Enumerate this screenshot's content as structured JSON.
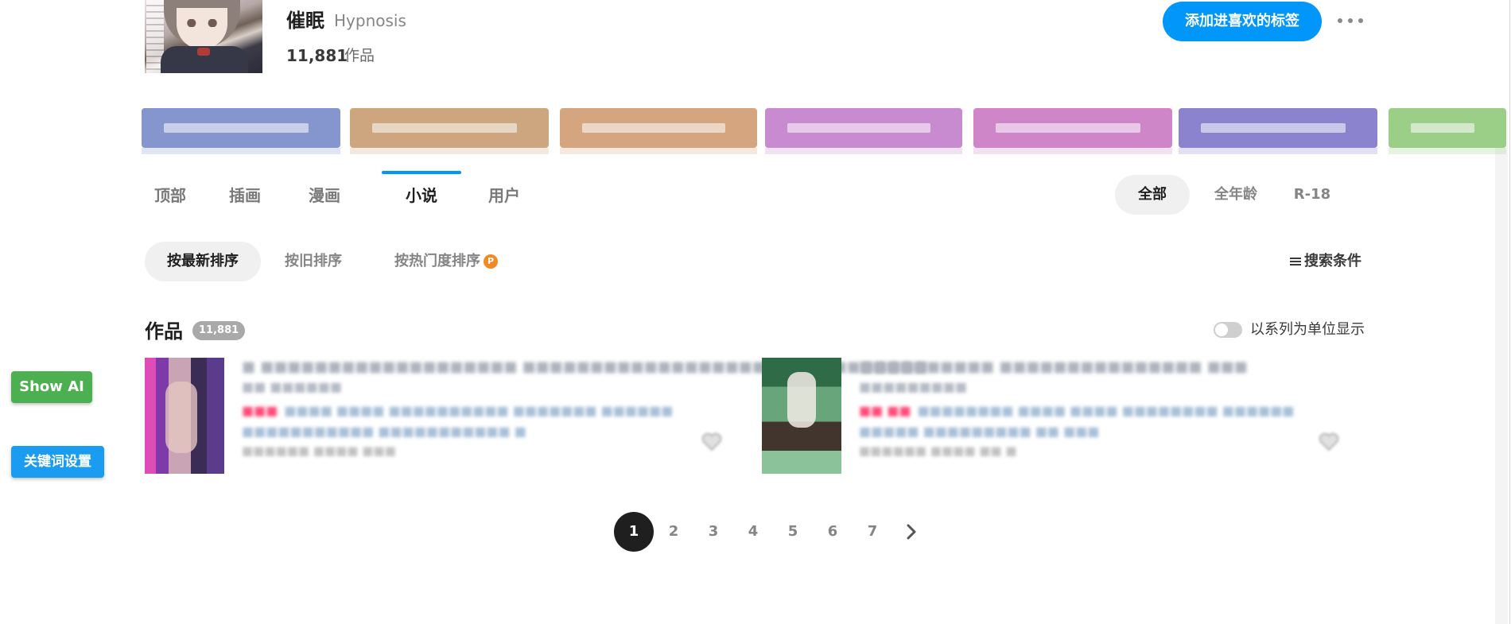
{
  "header": {
    "title": "催眠",
    "roman": "Hypnosis",
    "count": "11,881",
    "count_unit": "作品",
    "fav_button": "添加进喜欢的标签"
  },
  "related_tags": [
    {
      "color": "#8596cf"
    },
    {
      "color": "#cda57f"
    },
    {
      "color": "#d4a57e"
    },
    {
      "color": "#c98bcf"
    },
    {
      "color": "#cf86c9"
    },
    {
      "color": "#8b83cd"
    },
    {
      "color": "#9bcf88"
    }
  ],
  "categories": [
    "顶部",
    "插画",
    "漫画",
    "小说",
    "用户"
  ],
  "active_category": "小说",
  "age_filters": [
    "全部",
    "全年龄",
    "R-18"
  ],
  "active_age_filter": "全部",
  "sort_options": [
    "按最新排序",
    "按旧排序",
    "按热门度排序"
  ],
  "premium_badge": "P",
  "search_conditions": "搜索条件",
  "works": {
    "title": "作品",
    "count": "11,881",
    "series_toggle_label": "以系列为单位显示",
    "series_toggle_on": false
  },
  "pagination": {
    "pages": [
      "1",
      "2",
      "3",
      "4",
      "5",
      "6",
      "7"
    ],
    "current": "1"
  },
  "left_buttons": {
    "show_ai": "Show AI",
    "keyword_settings": "关键词设置"
  },
  "colors": {
    "accent": "#0096fa",
    "show_ai": "#4caf50",
    "keyword": "#1a9cf0",
    "r18": "#ff4d7a"
  }
}
